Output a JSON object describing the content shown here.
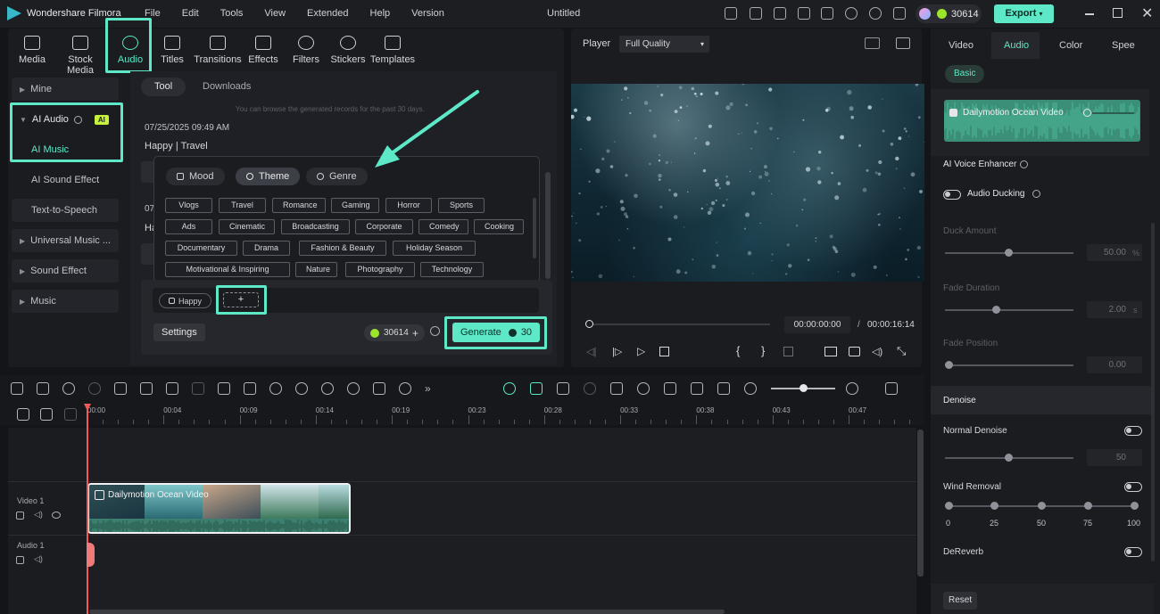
{
  "app": {
    "name": "Wondershare Filmora",
    "menu": [
      "File",
      "Edit",
      "Tools",
      "View",
      "Extended",
      "Help",
      "Version"
    ],
    "doc_title": "Untitled",
    "credits": "30614",
    "export_label": "Export"
  },
  "categories": [
    "Media",
    "Stock Media",
    "Audio",
    "Titles",
    "Transitions",
    "Effects",
    "Filters",
    "Stickers",
    "Templates"
  ],
  "sidebar": {
    "mine": "Mine",
    "ai_audio": "AI Audio",
    "ai_badge": "AI",
    "ai_music": "AI Music",
    "ai_sound_effect": "AI Sound Effect",
    "tts": "Text-to-Speech",
    "universal_music": "Universal Music ...",
    "sound_effect": "Sound Effect",
    "music": "Music"
  },
  "library": {
    "tabs": [
      "Tool",
      "Downloads"
    ],
    "note": "You can browse the generated records for the past 30 days.",
    "record1_date": "07/25/2025 09:49 AM",
    "record1_tags": "Happy | Travel",
    "record2_date_partial": "07",
    "record2_tags_partial": "Ha"
  },
  "picker": {
    "tabs": [
      "Mood",
      "Theme",
      "Genre"
    ],
    "tags_row1": [
      "Vlogs",
      "Travel",
      "Romance",
      "Gaming",
      "Horror",
      "Sports"
    ],
    "tags_row2": [
      "Ads",
      "Cinematic",
      "Broadcasting",
      "Corporate",
      "Comedy",
      "Cooking"
    ],
    "tags_row3": [
      "Documentary",
      "Drama",
      "Fashion & Beauty",
      "Holiday Season"
    ],
    "tags_row4": [
      "Motivational & Inspiring",
      "Nature",
      "Photography",
      "Technology"
    ]
  },
  "prompt": {
    "selected_tag": "Happy",
    "add_symbol": "+",
    "settings_label": "Settings",
    "credits": "30614",
    "generate_label": "Generate",
    "generate_cost": "30"
  },
  "player": {
    "label": "Player",
    "quality": "Full Quality",
    "current_time": "00:00:00:00",
    "separator": "/",
    "total_time": "00:00:16:14"
  },
  "right_panel": {
    "tabs": [
      "Video",
      "Audio",
      "Color",
      "Speed"
    ],
    "basic_label": "Basic",
    "clip_name": "Dailymotion Ocean Video",
    "ai_voice_enhancer": "AI Voice Enhancer",
    "audio_ducking": "Audio Ducking",
    "duck_amount": "Duck Amount",
    "duck_value": "50.00",
    "duck_unit": "%",
    "fade_duration": "Fade Duration",
    "fade_duration_value": "2.00",
    "fade_duration_unit": "s",
    "fade_position": "Fade Position",
    "fade_position_value": "0.00",
    "denoise": "Denoise",
    "normal_denoise": "Normal Denoise",
    "normal_denoise_value": "50",
    "wind_removal": "Wind Removal",
    "wind_scale": [
      "0",
      "25",
      "50",
      "75",
      "100"
    ],
    "dereverb": "DeReverb",
    "reset_label": "Reset"
  },
  "timeline": {
    "ticks": [
      "00:00",
      "00:04",
      "00:09",
      "00:14",
      "00:19",
      "00:23",
      "00:28",
      "00:33",
      "00:38",
      "00:43",
      "00:47"
    ],
    "video_track": "Video 1",
    "audio_track": "Audio 1",
    "clip_label": "Dailymotion Ocean Video"
  },
  "colors": {
    "accent": "#5de8c7",
    "bg": "#141518",
    "panel": "#1b1c20"
  }
}
